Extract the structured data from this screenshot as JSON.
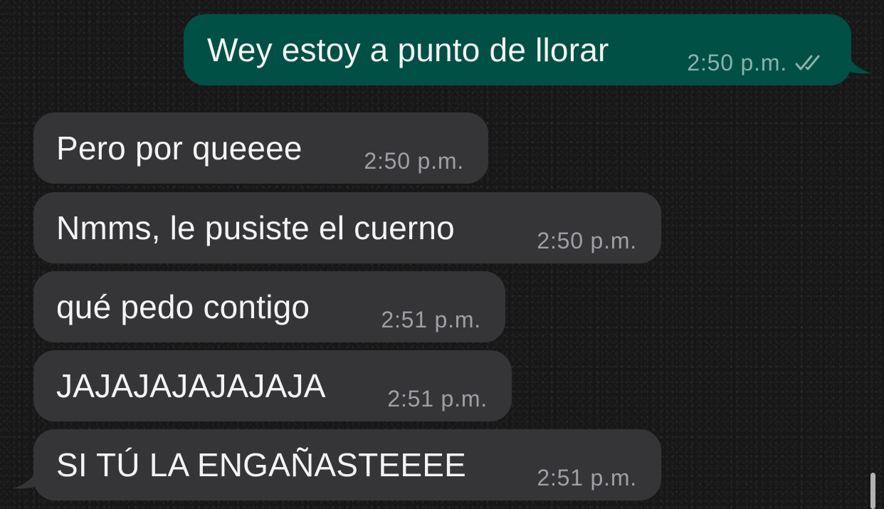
{
  "conversation": {
    "outgoing": [
      {
        "text": "Wey estoy a punto de llorar",
        "time": "2:50 p.m.",
        "status_icon": "double-check-icon",
        "bubble_color": "#005046"
      }
    ],
    "incoming": [
      {
        "text": "Pero por queeee",
        "time": "2:50 p.m."
      },
      {
        "text": "Nmms, le pusiste el cuerno",
        "time": "2:50 p.m."
      },
      {
        "text": "qué pedo contigo",
        "time": "2:51 p.m."
      },
      {
        "text": "JAJAJAJAJAJAJA",
        "time": "2:51 p.m."
      },
      {
        "text": "SI TÚ LA ENGAÑASTEEEE",
        "time": "2:51 p.m."
      }
    ],
    "incoming_bubble_color": "#353537",
    "background_color": "#171717"
  }
}
